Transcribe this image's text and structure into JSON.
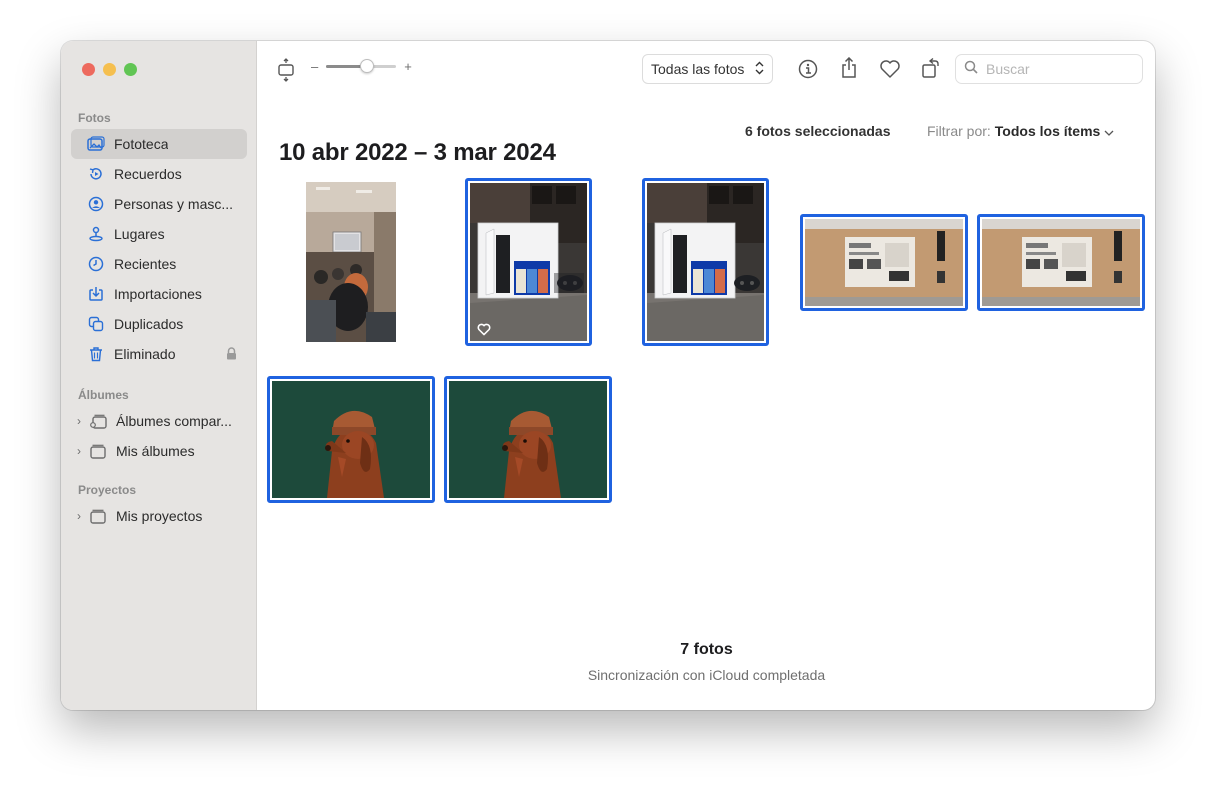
{
  "sidebar": {
    "sections": {
      "fotos": "Fotos",
      "albumes": "Álbumes",
      "proyectos": "Proyectos"
    },
    "items": [
      {
        "label": "Fototeca",
        "icon": "photo-library-icon"
      },
      {
        "label": "Recuerdos",
        "icon": "memories-icon"
      },
      {
        "label": "Personas y masc...",
        "icon": "people-icon"
      },
      {
        "label": "Lugares",
        "icon": "map-pin-icon"
      },
      {
        "label": "Recientes",
        "icon": "clock-icon"
      },
      {
        "label": "Importaciones",
        "icon": "import-icon"
      },
      {
        "label": "Duplicados",
        "icon": "duplicate-icon"
      },
      {
        "label": "Eliminado",
        "icon": "trash-icon"
      }
    ],
    "albums": [
      {
        "label": "Álbumes compar...",
        "icon": "shared-albums-icon"
      },
      {
        "label": "Mis álbumes",
        "icon": "albums-icon"
      }
    ],
    "projects": [
      {
        "label": "Mis proyectos",
        "icon": "projects-icon"
      }
    ]
  },
  "toolbar": {
    "zoom_minus": "–",
    "zoom_plus": "+",
    "zoom_level": 0.6,
    "view_select": "Todas las fotos",
    "search_placeholder": "Buscar"
  },
  "content": {
    "selected_count": "6 fotos seleccionadas",
    "filter_label": "Filtrar por:",
    "filter_value": "Todos los ítems",
    "date_range": "10 abr 2022 – 3 mar 2024"
  },
  "footer": {
    "count": "7 fotos",
    "sync": "Sincronización con iCloud completada"
  },
  "colors": {
    "selection": "#1f62e0",
    "accent": "#2a6fd6",
    "sidebar_bg": "#e6e4e2"
  }
}
